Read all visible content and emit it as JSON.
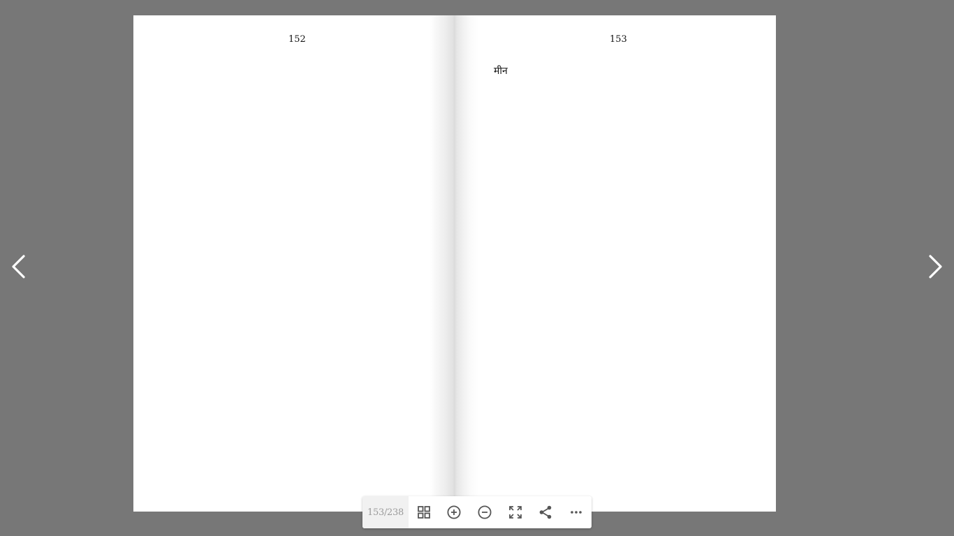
{
  "book": {
    "left_page": {
      "number": "152",
      "text": ""
    },
    "right_page": {
      "number": "153",
      "text": "मीन"
    }
  },
  "navigation": {
    "prev_icon": "chevron-left-icon",
    "next_icon": "chevron-right-icon"
  },
  "toolbar": {
    "page_counter": "153/238",
    "buttons": [
      {
        "icon": "grid-icon"
      },
      {
        "icon": "zoom-in-icon"
      },
      {
        "icon": "zoom-out-icon"
      },
      {
        "icon": "fullscreen-icon"
      },
      {
        "icon": "share-icon"
      },
      {
        "icon": "more-icon"
      }
    ]
  },
  "colors": {
    "background": "#777777",
    "page": "#ffffff",
    "toolbar": "#ffffff",
    "icon": "#555555"
  }
}
